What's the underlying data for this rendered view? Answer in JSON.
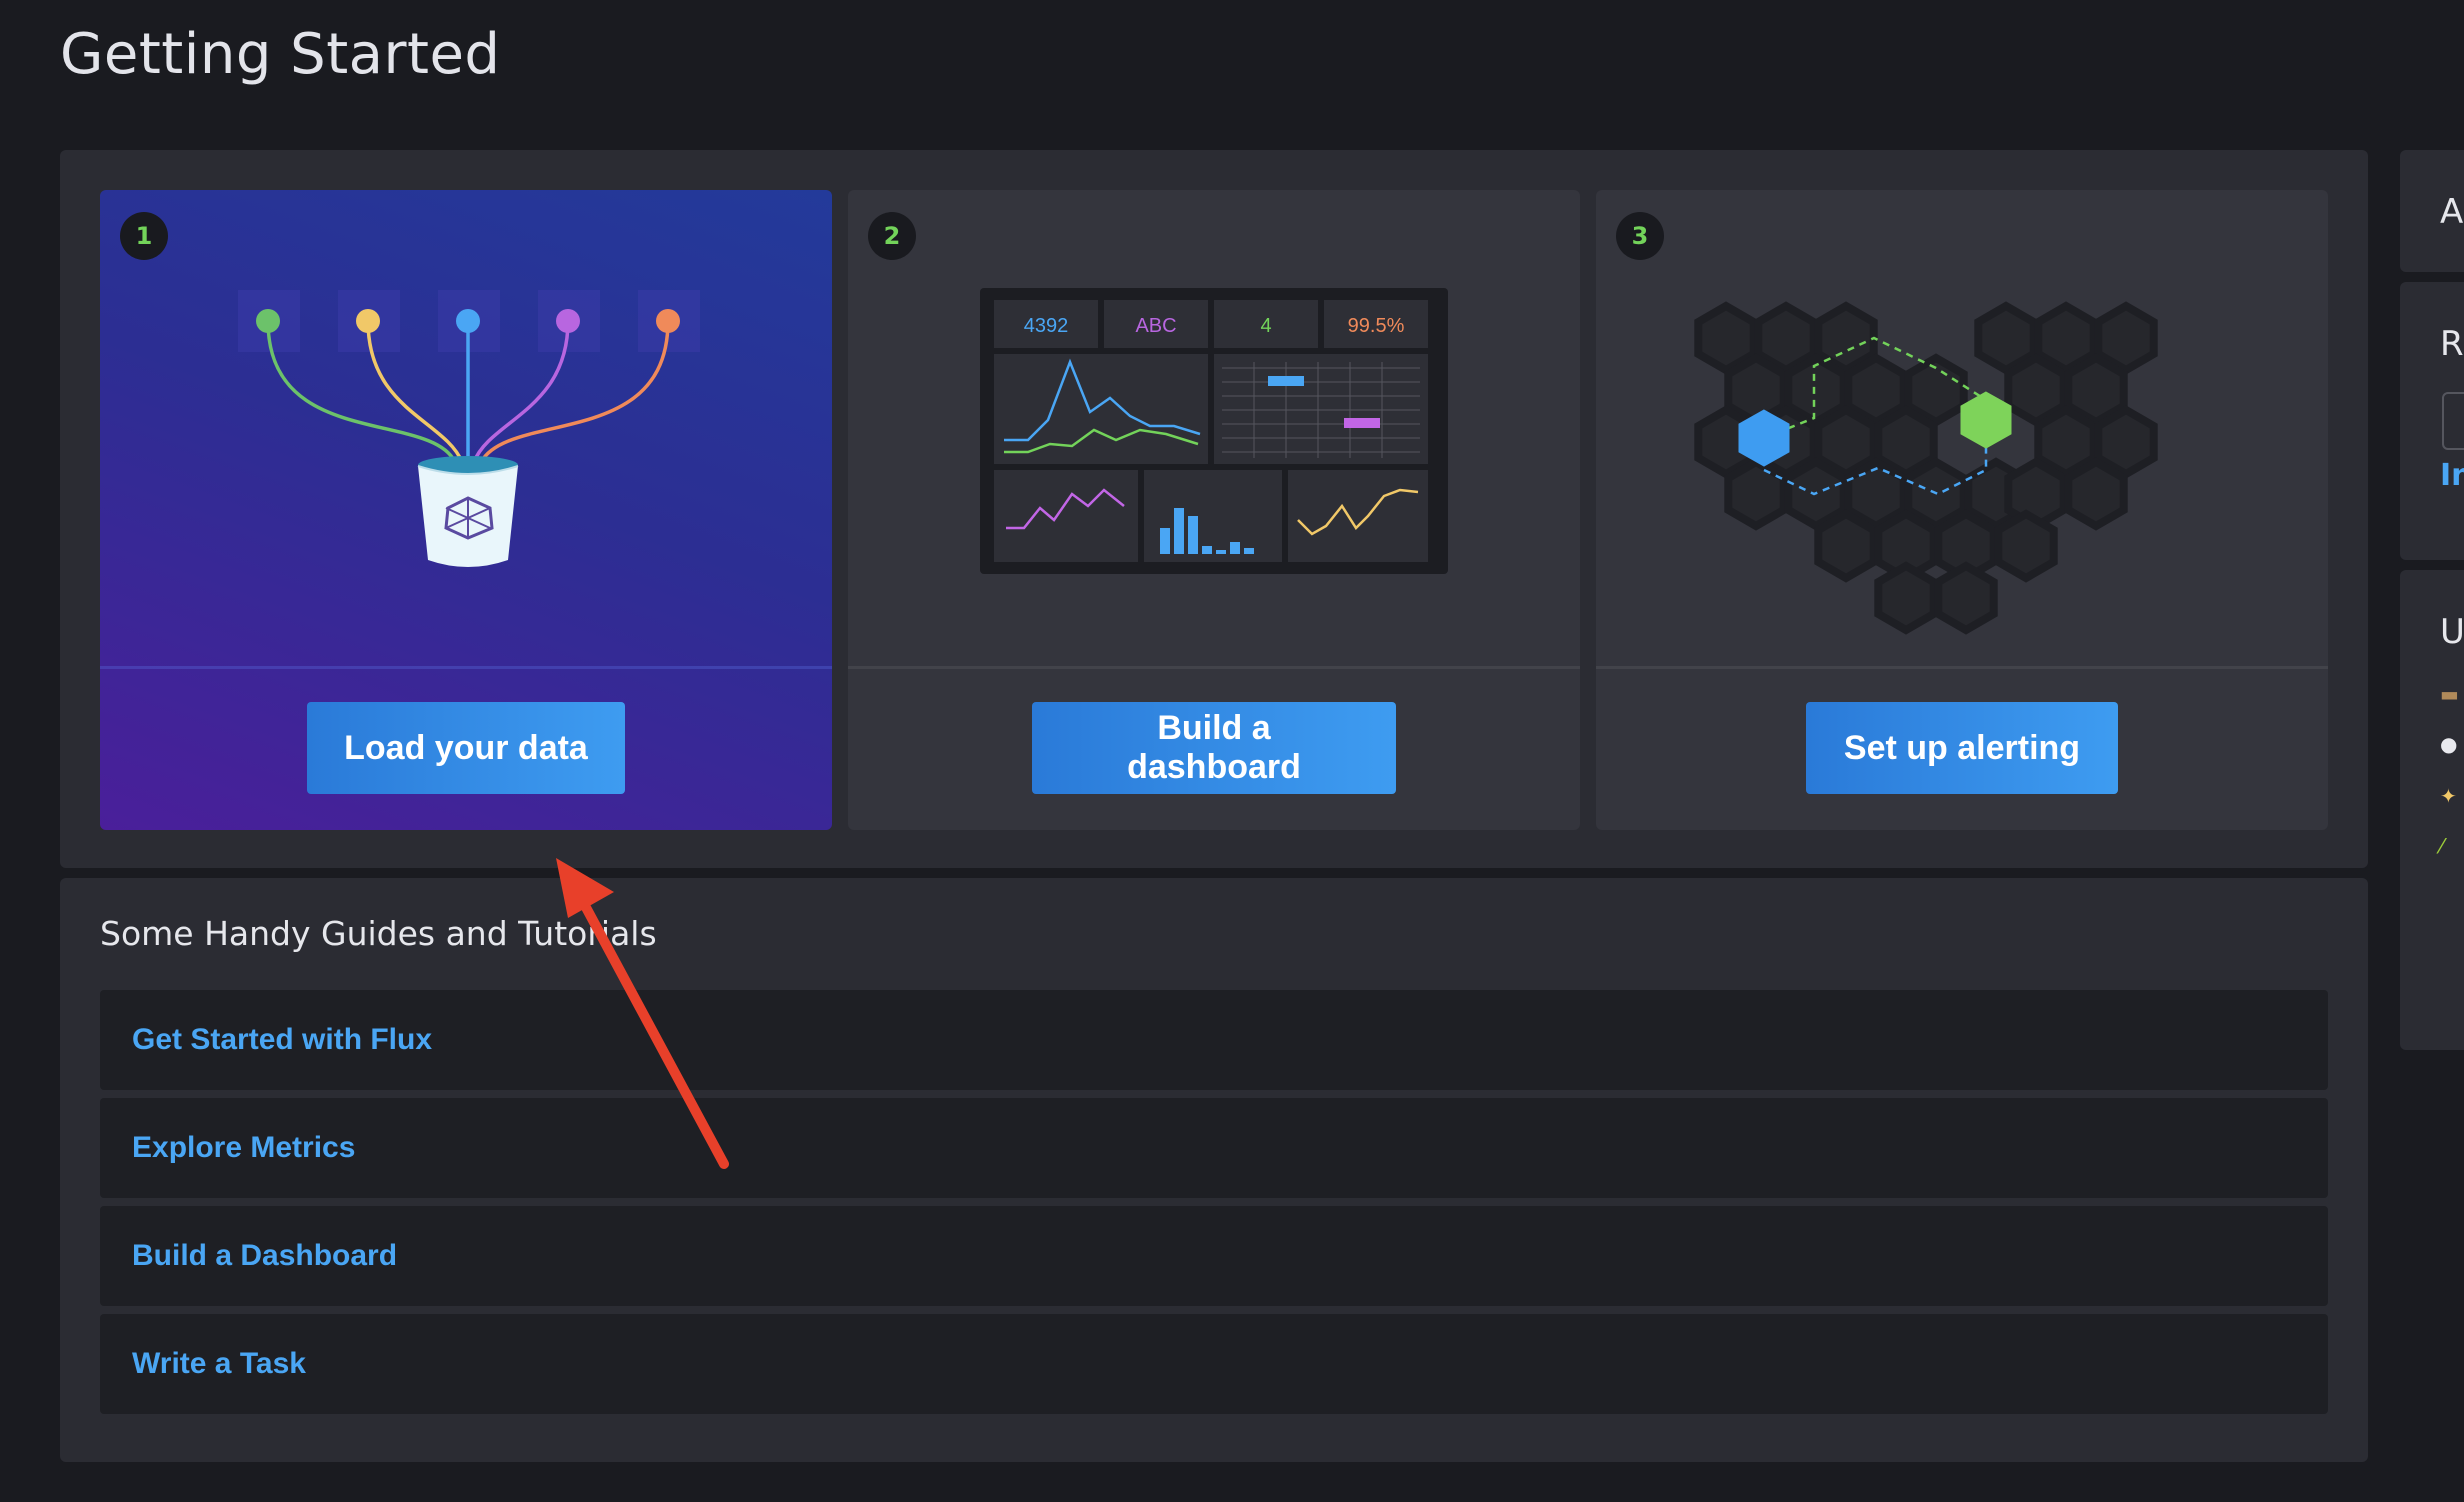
{
  "page": {
    "title": "Getting Started"
  },
  "steps": [
    {
      "number": "1",
      "button_label": "Load your data",
      "active": true
    },
    {
      "number": "2",
      "button_label": "Build a dashboard",
      "active": false
    },
    {
      "number": "3",
      "button_label": "Set up alerting",
      "active": false
    }
  ],
  "dashboard_preview": {
    "stats": [
      "4392",
      "ABC",
      "4",
      "99.5%"
    ]
  },
  "guides": {
    "heading": "Some Handy Guides and Tutorials",
    "items": [
      {
        "label": "Get Started with Flux"
      },
      {
        "label": "Explore Metrics"
      },
      {
        "label": "Build a Dashboard"
      },
      {
        "label": "Write a Task"
      }
    ]
  },
  "right_column": {
    "letters": [
      "A",
      "R",
      "U"
    ],
    "link_fragment": "In"
  },
  "colors": {
    "accent_blue": "#3e9cf1",
    "link_blue": "#4aa6f4",
    "step_green": "#73d35a",
    "annotation_red": "#e8402a"
  }
}
